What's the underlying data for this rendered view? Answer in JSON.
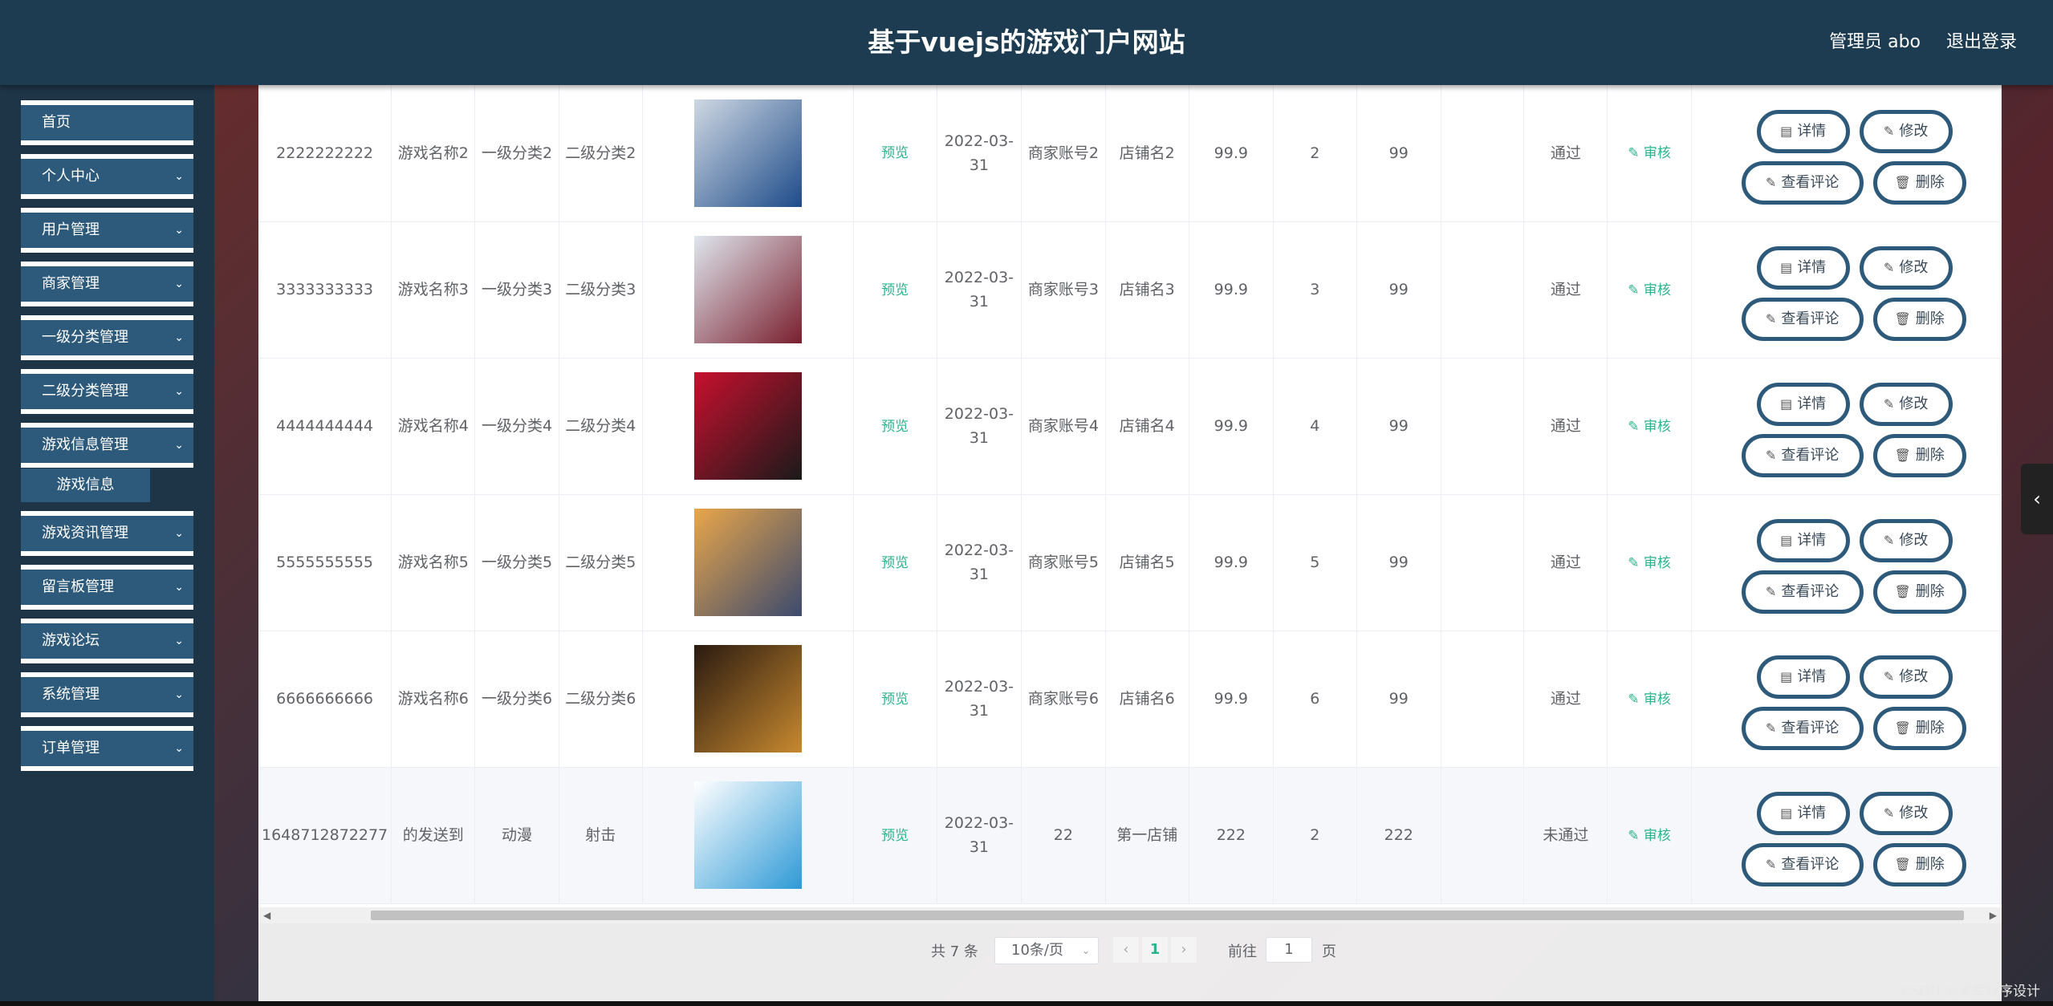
{
  "header": {
    "title": "基于vuejs的游戏门户网站",
    "user": "管理员 abo",
    "logout": "退出登录"
  },
  "sidebar": {
    "items": [
      {
        "label": "首页"
      },
      {
        "label": "个人中心"
      },
      {
        "label": "用户管理"
      },
      {
        "label": "商家管理"
      },
      {
        "label": "一级分类管理"
      },
      {
        "label": "二级分类管理"
      },
      {
        "label": "游戏信息管理"
      },
      {
        "label": "游戏资讯管理"
      },
      {
        "label": "留言板管理"
      },
      {
        "label": "游戏论坛"
      },
      {
        "label": "系统管理"
      },
      {
        "label": "订单管理"
      }
    ],
    "sub_item": "游戏信息",
    "chevron": "chevron-down-icon"
  },
  "table": {
    "preview_label": "预览",
    "audit_label": "审核",
    "buttons": {
      "detail": "详情",
      "edit": "修改",
      "comments": "查看评论",
      "delete": "删除"
    },
    "rows": [
      {
        "id": "2222222222",
        "name": "游戏名称2",
        "cat1": "一级分类2",
        "cat2": "二级分类2",
        "date": "2022-03-31",
        "merchant": "商家账号2",
        "shop": "店铺名2",
        "price": "99.9",
        "c1": "2",
        "c2": "99",
        "status": "通过"
      },
      {
        "id": "3333333333",
        "name": "游戏名称3",
        "cat1": "一级分类3",
        "cat2": "二级分类3",
        "date": "2022-03-31",
        "merchant": "商家账号3",
        "shop": "店铺名3",
        "price": "99.9",
        "c1": "3",
        "c2": "99",
        "status": "通过"
      },
      {
        "id": "4444444444",
        "name": "游戏名称4",
        "cat1": "一级分类4",
        "cat2": "二级分类4",
        "date": "2022-03-31",
        "merchant": "商家账号4",
        "shop": "店铺名4",
        "price": "99.9",
        "c1": "4",
        "c2": "99",
        "status": "通过"
      },
      {
        "id": "5555555555",
        "name": "游戏名称5",
        "cat1": "一级分类5",
        "cat2": "二级分类5",
        "date": "2022-03-31",
        "merchant": "商家账号5",
        "shop": "店铺名5",
        "price": "99.9",
        "c1": "5",
        "c2": "99",
        "status": "通过"
      },
      {
        "id": "6666666666",
        "name": "游戏名称6",
        "cat1": "一级分类6",
        "cat2": "二级分类6",
        "date": "2022-03-31",
        "merchant": "商家账号6",
        "shop": "店铺名6",
        "price": "99.9",
        "c1": "6",
        "c2": "99",
        "status": "通过"
      },
      {
        "id": "1648712872277",
        "name": "的发送到",
        "cat1": "动漫",
        "cat2": "射击",
        "date": "2022-03-31",
        "merchant": "22",
        "shop": "第一店铺",
        "price": "222",
        "c1": "2",
        "c2": "222",
        "status": "未通过"
      }
    ]
  },
  "pagination": {
    "total": "共 7 条",
    "page_size": "10条/页",
    "current_page": "1",
    "goto_label": "前往",
    "goto_value": "1",
    "page_unit": "页"
  },
  "watermark": "CSDN @灵军程序设计",
  "colors": {
    "header": "#1d3c51",
    "menu": "#2d5a7a",
    "link": "#2ab38c"
  }
}
